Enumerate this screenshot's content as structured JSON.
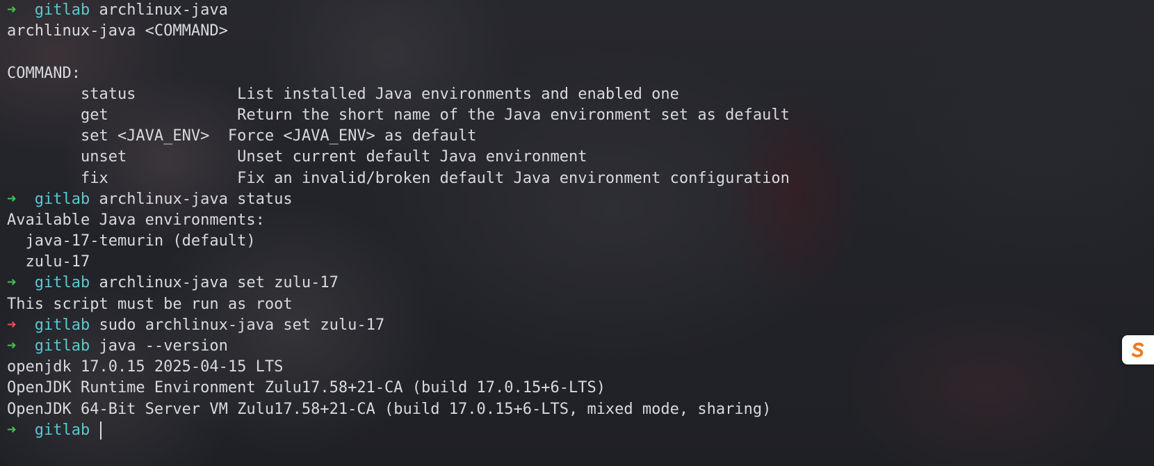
{
  "prompt": {
    "arrow": "➜",
    "directory": "gitlab"
  },
  "lines": [
    {
      "type": "prompt",
      "status": "ok",
      "command": "archlinux-java"
    },
    {
      "type": "output",
      "text": "archlinux-java <COMMAND>"
    },
    {
      "type": "output",
      "text": ""
    },
    {
      "type": "output",
      "text": "COMMAND:"
    },
    {
      "type": "output",
      "text": "        status           List installed Java environments and enabled one"
    },
    {
      "type": "output",
      "text": "        get              Return the short name of the Java environment set as default"
    },
    {
      "type": "output",
      "text": "        set <JAVA_ENV>  Force <JAVA_ENV> as default"
    },
    {
      "type": "output",
      "text": "        unset            Unset current default Java environment"
    },
    {
      "type": "output",
      "text": "        fix              Fix an invalid/broken default Java environment configuration"
    },
    {
      "type": "prompt",
      "status": "ok",
      "command": "archlinux-java status"
    },
    {
      "type": "output",
      "text": "Available Java environments:"
    },
    {
      "type": "output",
      "text": "  java-17-temurin (default)"
    },
    {
      "type": "output",
      "text": "  zulu-17"
    },
    {
      "type": "prompt",
      "status": "ok",
      "command": "archlinux-java set zulu-17"
    },
    {
      "type": "output",
      "text": "This script must be run as root"
    },
    {
      "type": "prompt",
      "status": "error",
      "command": "sudo archlinux-java set zulu-17"
    },
    {
      "type": "prompt",
      "status": "ok",
      "command": "java --version"
    },
    {
      "type": "output",
      "text": "openjdk 17.0.15 2025-04-15 LTS"
    },
    {
      "type": "output",
      "text": "OpenJDK Runtime Environment Zulu17.58+21-CA (build 17.0.15+6-LTS)"
    },
    {
      "type": "output",
      "text": "OpenJDK 64-Bit Server VM Zulu17.58+21-CA (build 17.0.15+6-LTS, mixed mode, sharing)"
    },
    {
      "type": "prompt",
      "status": "ok",
      "command": "",
      "active": true
    }
  ],
  "colors": {
    "arrow_ok": "#3fc456",
    "arrow_error": "#e0565e",
    "directory": "#5cc8cf",
    "text": "#d8dade",
    "ime_badge_accent": "#f07a1f"
  },
  "ime_badge": {
    "icon": "sogou-s-icon"
  }
}
